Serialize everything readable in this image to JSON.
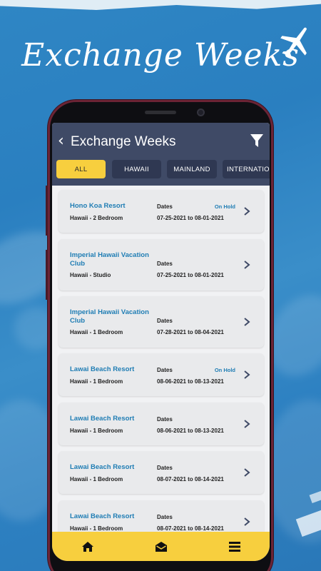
{
  "banner": {
    "headline": "Exchange Weeks",
    "plane_icon": "airplane-icon"
  },
  "app": {
    "header": {
      "title": "Exchange Weeks",
      "back_icon": "back-chevron-icon",
      "filter_icon": "filter-icon",
      "back_glyph": "‹"
    },
    "tabs": [
      {
        "label": "ALL",
        "active": true
      },
      {
        "label": "HAWAII",
        "active": false
      },
      {
        "label": "MAINLAND",
        "active": false
      },
      {
        "label": "INTERNATION",
        "active": false
      }
    ],
    "cards": [
      {
        "name": "Hono Koa Resort",
        "unit": "Hawaii - 2 Bedroom",
        "dates_label": "Dates",
        "dates": "07-25-2021 to 08-01-2021",
        "status": "On Hold"
      },
      {
        "name": "Imperial Hawaii Vacation Club",
        "unit": "Hawaii - Studio",
        "dates_label": "Dates",
        "dates": "07-25-2021 to 08-01-2021",
        "status": ""
      },
      {
        "name": "Imperial Hawaii Vacation Club",
        "unit": "Hawaii - 1 Bedroom",
        "dates_label": "Dates",
        "dates": "07-28-2021 to 08-04-2021",
        "status": ""
      },
      {
        "name": "Lawai Beach Resort",
        "unit": "Hawaii - 1 Bedroom",
        "dates_label": "Dates",
        "dates": "08-06-2021 to 08-13-2021",
        "status": "On Hold"
      },
      {
        "name": "Lawai Beach Resort",
        "unit": "Hawaii - 1 Bedroom",
        "dates_label": "Dates",
        "dates": "08-06-2021 to 08-13-2021",
        "status": ""
      },
      {
        "name": "Lawai Beach Resort",
        "unit": "Hawaii - 1 Bedroom",
        "dates_label": "Dates",
        "dates": "08-07-2021 to 08-14-2021",
        "status": ""
      },
      {
        "name": "Lawai Beach Resort",
        "unit": "Hawaii - 1 Bedroom",
        "dates_label": "Dates",
        "dates": "08-07-2021 to 08-14-2021",
        "status": ""
      }
    ],
    "bottom_nav": [
      {
        "icon": "home-icon"
      },
      {
        "icon": "mail-icon"
      },
      {
        "icon": "menu-icon"
      }
    ]
  },
  "colors": {
    "background_blue": "#2f86c4",
    "header_navy": "#3f4a66",
    "tab_dark": "#2f3852",
    "accent_yellow": "#f7cf3e",
    "link_blue": "#1f7db4",
    "phone_frame": "#6b2436"
  }
}
